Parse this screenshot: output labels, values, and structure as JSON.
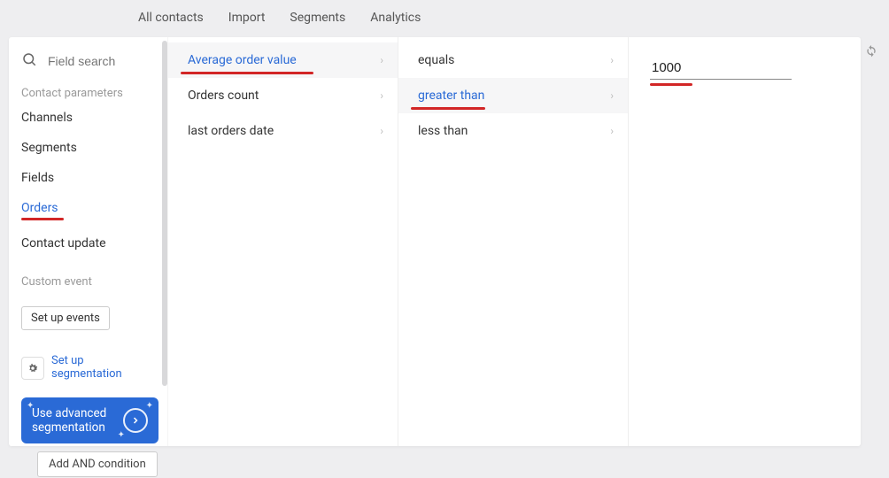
{
  "topnav": {
    "items": [
      "All contacts",
      "Import",
      "Segments",
      "Analytics"
    ]
  },
  "sidebar": {
    "search_placeholder": "Field search",
    "contact_params_label": "Contact parameters",
    "params": [
      {
        "label": "Channels",
        "active": false
      },
      {
        "label": "Segments",
        "active": false
      },
      {
        "label": "Fields",
        "active": false
      },
      {
        "label": "Orders",
        "active": true
      },
      {
        "label": "Contact update",
        "active": false
      }
    ],
    "custom_event_label": "Custom event",
    "setup_events_btn": "Set up events",
    "setup_seg_link": "Set up\nsegmentation",
    "adv_seg_label": "Use advanced segmentation"
  },
  "fields": {
    "items": [
      {
        "label": "Average order value",
        "active": true,
        "underline_width": 150
      },
      {
        "label": "Orders count",
        "active": false
      },
      {
        "label": "last orders date",
        "active": false
      }
    ]
  },
  "operators": {
    "items": [
      {
        "label": "equals",
        "active": false
      },
      {
        "label": "greater than",
        "active": true,
        "underline_width": 84
      },
      {
        "label": "less than",
        "active": false
      }
    ]
  },
  "value": {
    "input_value": "1000"
  },
  "and_condition_btn": "Add AND condition"
}
